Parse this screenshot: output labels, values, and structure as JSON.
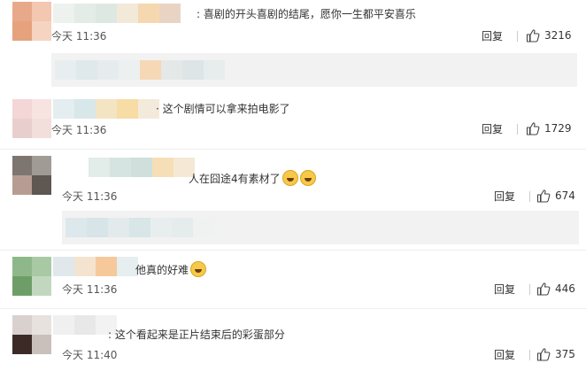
{
  "comments": [
    {
      "text": "喜剧的开头喜剧的结尾，愿你一生都平安喜乐",
      "time": "今天 11:36",
      "reply_label": "回复",
      "likes": "3216",
      "avatar_colors": [
        "#e8a98a",
        "#f3c7b0",
        "#e6a27d",
        "#f5d4c2"
      ],
      "name_colors": [
        "#eef2ef",
        "#e4ece8",
        "#dde8e2",
        "#f2e9d8",
        "#f6d8b0",
        "#e9d4c4"
      ]
    },
    {
      "text": "这个剧情可以拿来拍电影了",
      "time": "今天 11:36",
      "reply_label": "回复",
      "likes": "1729",
      "avatar_colors": [
        "#f4d6d6",
        "#f7e4e1",
        "#e8cfcd",
        "#f2dedb"
      ],
      "name_colors": [
        "#e4edf0",
        "#d8e7ea",
        "#f3e4c4",
        "#f7dca6",
        "#f3eadb"
      ]
    },
    {
      "text": "人在囧途4有素材了",
      "time": "今天 11:36",
      "reply_label": "回复",
      "likes": "674",
      "avatar_colors": [
        "#7c7570",
        "#a19b96",
        "#b69c92",
        "#5e5752"
      ],
      "name_colors": [
        "#e2ece9",
        "#d5e4e1",
        "#cfe0dc",
        "#f6dfb6",
        "#f5e8d5"
      ]
    },
    {
      "text": "他真的好难",
      "time": "今天 11:36",
      "reply_label": "回复",
      "likes": "446",
      "avatar_colors": [
        "#8fb88a",
        "#a9c9a4",
        "#6e9e68",
        "#c2d8be"
      ],
      "name_colors": [
        "#e0e8ec",
        "#f4e3cf",
        "#f6c99a",
        "#e6eef0"
      ]
    },
    {
      "text": "这个看起来是正片结束后的彩蛋部分",
      "time": "今天 11:40",
      "reply_label": "回复",
      "likes": "375",
      "avatar_colors": [
        "#d8d1ce",
        "#e8e2df",
        "#3b2a26",
        "#c9bfbb"
      ],
      "name_colors": [
        "#f0f0f0",
        "#e8e8e8",
        "#f2f2f2"
      ]
    }
  ],
  "subreplies": [
    {
      "colors": [
        "#e8eef0",
        "#dfe9ec",
        "#e6ecee",
        "#ecf0f0",
        "#f6d8b7",
        "#e4e9e8",
        "#dde5e6",
        "#e7ecec"
      ]
    },
    {
      "colors": [
        "#dde8ec",
        "#d7e4e8",
        "#e2eaec",
        "#d8e6e8",
        "#e8eeee",
        "#e4ecec",
        "#f0f2f2"
      ]
    }
  ],
  "icons": {
    "like": "thumbs-up-icon",
    "emoji": "laughing-tears-emoji-icon"
  },
  "colors": {
    "text": "#333333",
    "meta": "#555555",
    "subreply_bg": "#f2f2f2"
  }
}
